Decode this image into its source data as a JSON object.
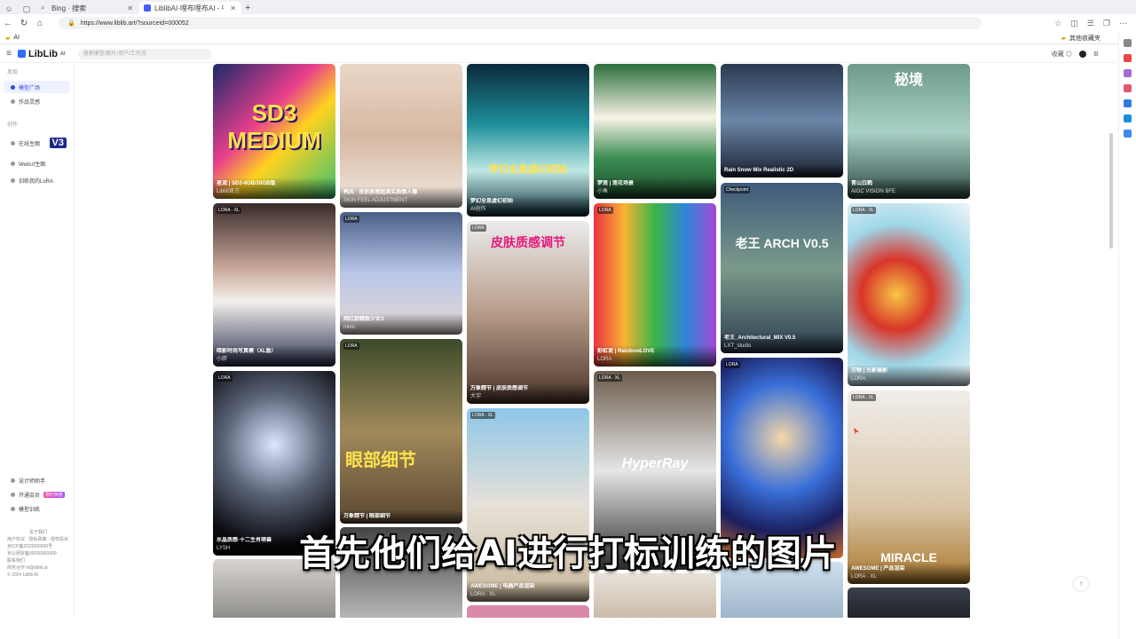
{
  "browser": {
    "tabs": [
      {
        "label": "Bing · 搜索",
        "active": false
      },
      {
        "label": "LiblibAI·哩布哩布AI - 中国领先的AI...",
        "active": true
      }
    ],
    "url": "https://www.liblib.art/?sourceId=000052",
    "bookmark_left": "AI",
    "bookmark_right": "其他收藏夹"
  },
  "app": {
    "logo": "LibLib",
    "logo_sup": "AI",
    "search_placeholder": "搜索模型/图片/用户/工作流",
    "header_right": "收藏 ◎"
  },
  "sidebar": {
    "group1": "发现",
    "items": [
      {
        "label": "模型广场",
        "active": true
      },
      {
        "label": "作品灵感",
        "active": false
      }
    ],
    "group2": "创作",
    "tools": [
      {
        "label": "在线生图",
        "badge": "V3"
      },
      {
        "label": "WebUI生图"
      },
      {
        "label": "训练我的LoRA"
      }
    ],
    "bottom": [
      {
        "label": "设计师助手"
      },
      {
        "label": "开通会员",
        "badge": "限时特惠"
      },
      {
        "label": "模型训练"
      }
    ],
    "footer_lines": [
      "关于我们",
      "用户协议 · 隐私政策 · 侵权投诉",
      "京ICP备2023000000号",
      "京公网安备00000000000",
      "联系我们",
      "商务合作 hi@liblib.ai",
      "© 2024 Liblib AI"
    ]
  },
  "cards": [
    {
      "title": "星流 | SD3-4GB/10GB版",
      "meta": "Liblib官方",
      "big": "SD3 MEDIUM"
    },
    {
      "title": "韩风 · 皮肤质感超真实质感人像",
      "meta": "SKIN FEEL ADJUSTMENT",
      "big": ""
    },
    {
      "title": "梦幻全息虚幻初始",
      "meta": "AI创作",
      "big": "梦幻全息虚幻初始"
    },
    {
      "title": "梦莲 | 莲花场景",
      "meta": "小鱼",
      "big": ""
    },
    {
      "title": "Rain Snow Mix Realistic 2D",
      "meta": "Checkpoint",
      "big": ""
    },
    {
      "title": "青山白鹤",
      "meta": "AIGC VISION BFE",
      "big": "秘境"
    },
    {
      "title": "暗影时尚写真模（XL版）",
      "meta": "小胖",
      "big": ""
    },
    {
      "title": "网红脸精致少女3",
      "meta": "mimi",
      "big": ""
    },
    {
      "title": "万象精节 | 皮肤质感调节",
      "meta": "大宇",
      "big": "皮肤质感调节"
    },
    {
      "title": "彩虹发 | RainbowLOVE",
      "meta": "LORA",
      "big": ""
    },
    {
      "title": "老王_Architectural_MIX V0.5",
      "meta": "LXT_studio",
      "big": "老王 ARCH V0.5"
    },
    {
      "title": "万物 | 光影摄影",
      "meta": "LORA",
      "big": ""
    },
    {
      "title": "水晶质感·十二生肖萌兽",
      "meta": "LYSH",
      "big": ""
    },
    {
      "title": "万象精节 | 眼部细节",
      "meta": "LORA",
      "big": "眼部细节"
    },
    {
      "title": "AWESOME | 电器产品渲染",
      "meta": "LORA · XL",
      "big": ""
    },
    {
      "title": "HyperRay",
      "meta": "LORA",
      "big": "HyperRay"
    },
    {
      "title": "星云 | 宇宙幻境",
      "meta": "LORA",
      "big": ""
    },
    {
      "title": "AWESOME | 产品渲染",
      "meta": "LORA · XL",
      "big": "MIRACLE"
    }
  ],
  "subtitle": "首先他们给AI进行打标训练的图片",
  "colors": {
    "accent": "#2b4bdd",
    "brand": "#2b6df6"
  }
}
